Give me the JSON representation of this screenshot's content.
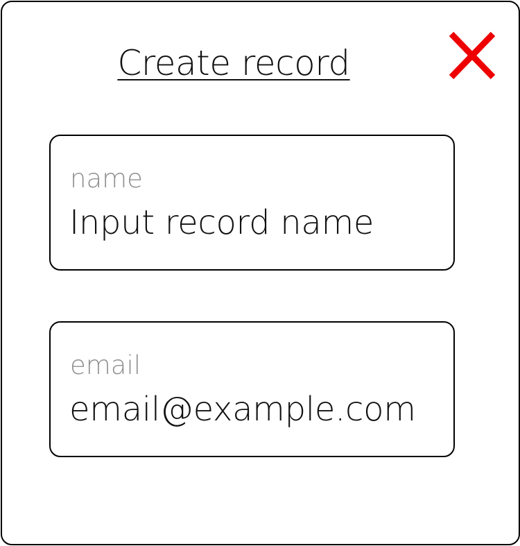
{
  "dialog": {
    "title": "Create record",
    "close_icon": "close-icon",
    "close_color": "#ee0000"
  },
  "fields": {
    "name": {
      "label": "name",
      "value": "Input record name"
    },
    "email": {
      "label": "email",
      "value": "email@example.com"
    }
  }
}
